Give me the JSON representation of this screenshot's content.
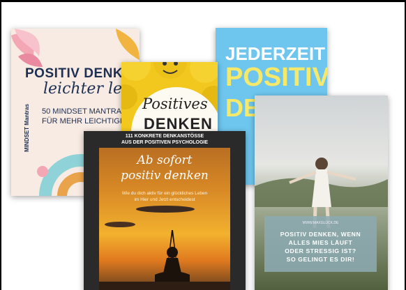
{
  "covers": {
    "c1": {
      "title_line1": "POSITIV DENKEN",
      "title_line2": "leichter leben",
      "subtitle_line1": "50 MINDSET MANTRAS",
      "subtitle_line2": "FÜR MEHR LEICHTIGKEIT",
      "side_text": "MINDSET Mantras"
    },
    "c2": {
      "title_line1": "Positives",
      "title_line2": "DENKEN"
    },
    "c3": {
      "title_line1": "JEDERZEIT",
      "title_line2": "POSITIV",
      "title_line3": "DENKEN"
    },
    "c4": {
      "top_line1": "111 KONKRETE DENKANSTÖSSE",
      "top_line2": "AUS DER POSITIVEN PSYCHOLOGIE",
      "title_line1": "Ab sofort",
      "title_line2": "positiv denken",
      "desc_line1": "Wie du dich aktiv für ein glückliches Leben",
      "desc_line2": "im Hier und Jetzt entscheidest"
    },
    "c5": {
      "url": "WWW.MAXGLÜCK.DE",
      "line1": "POSITIV DENKEN, WENN",
      "line2": "ALLES MIES LÄUFT",
      "line3": "ODER STRESSIG IST?",
      "line4": "SO GELINGT ES DIR!"
    }
  },
  "colors": {
    "navy": "#1e2f52",
    "yellow": "#f2c81e",
    "sky": "#6ec6ee",
    "lemon": "#f6e96a",
    "teal_box": "#8caab0"
  }
}
